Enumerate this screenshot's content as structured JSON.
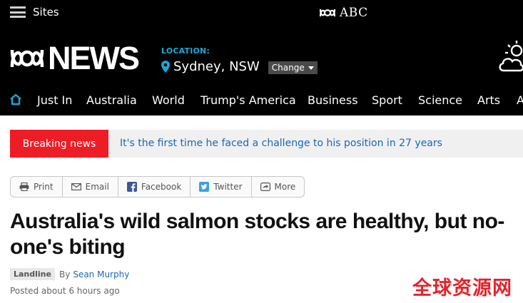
{
  "topbar": {
    "sites_label": "Sites",
    "abc_label": "ABC"
  },
  "header": {
    "logo_word": "NEWS",
    "location_label": "LOCATION:",
    "location_name": "Sydney, NSW",
    "change_label": "Change",
    "weather_icon": "partly-cloudy-icon"
  },
  "nav": {
    "home_icon": "home-icon",
    "items": [
      {
        "label": "Just In"
      },
      {
        "label": "Australia"
      },
      {
        "label": "World"
      },
      {
        "label": "Trump's America"
      },
      {
        "label": "Business"
      },
      {
        "label": "Sport"
      },
      {
        "label": "Science"
      },
      {
        "label": "Arts"
      },
      {
        "label": "A"
      }
    ]
  },
  "breaking": {
    "label": "Breaking news",
    "text": "It's the first time he faced a challenge to his position in 27 years"
  },
  "share": {
    "items": [
      {
        "label": "Print",
        "icon": "printer-icon"
      },
      {
        "label": "Email",
        "icon": "envelope-icon"
      },
      {
        "label": "Facebook",
        "icon": "facebook-icon"
      },
      {
        "label": "Twitter",
        "icon": "twitter-icon"
      },
      {
        "label": "More",
        "icon": "share-icon"
      }
    ]
  },
  "article": {
    "headline": "Australia's wild salmon stocks are healthy, but no-one's biting",
    "program_tag": "Landline",
    "by_prefix": "By",
    "author": "Sean Murphy",
    "posted": "Posted about 6 hours ago"
  },
  "watermark": {
    "text": "全球资源网"
  },
  "colors": {
    "header_bg": "#000000",
    "accent_blue": "#1aa7d8",
    "breaking_red": "#ee1c25",
    "link_blue": "#1a68b5",
    "watermark_red": "#e2242b"
  }
}
